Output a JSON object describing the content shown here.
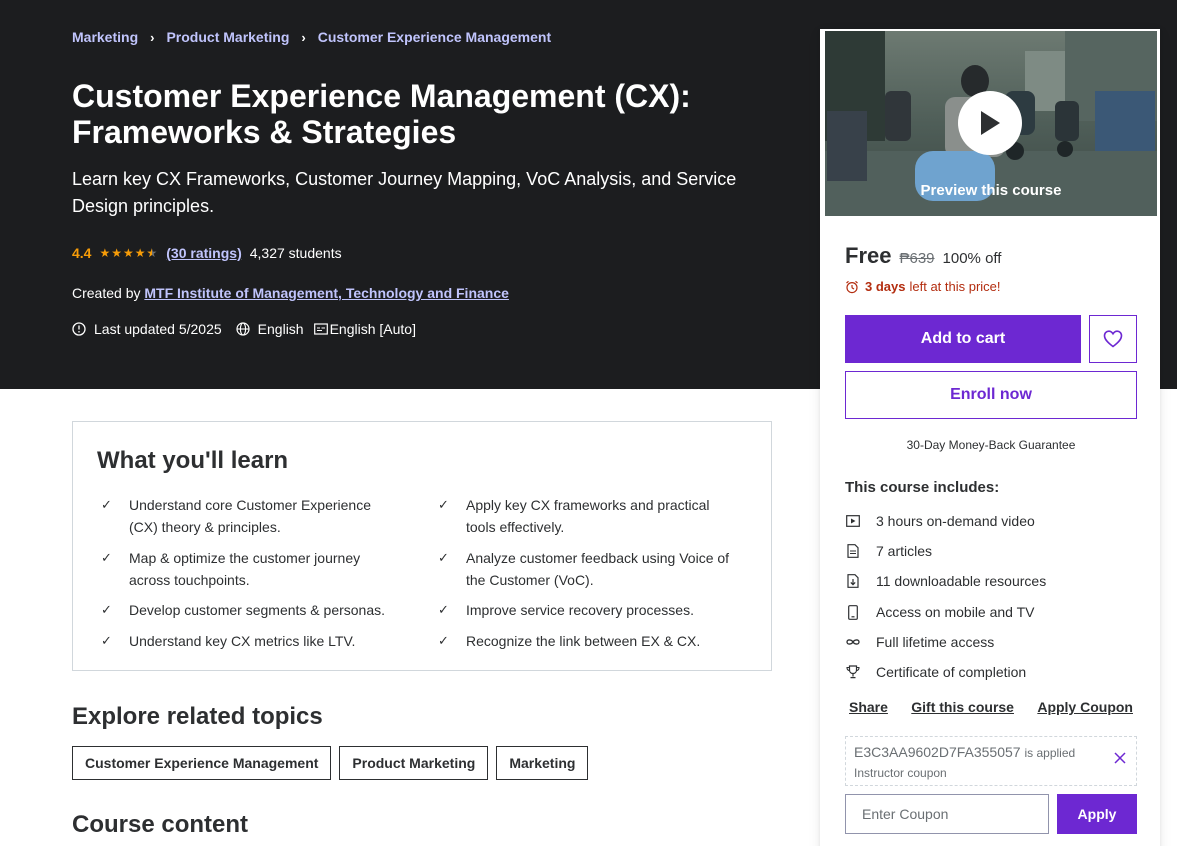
{
  "breadcrumb": [
    "Marketing",
    "Product Marketing",
    "Customer Experience Management"
  ],
  "course": {
    "title_line1": "Customer Experience Management (CX):",
    "title_line2": "Frameworks & Strategies",
    "subtitle": "Learn key CX Frameworks, Customer Journey Mapping, VoC Analysis, and Service Design principles.",
    "rating": "4.4",
    "rating_stars": 4.4,
    "ratings_count": "(30 ratings)",
    "students": "4,327 students",
    "created_by_label": "Created by",
    "instructor": "MTF Institute of Management, Technology and Finance",
    "last_updated": "Last updated 5/2025",
    "language": "English",
    "captions": "English [Auto]"
  },
  "learn": {
    "title": "What you'll learn",
    "items": [
      "Understand core Customer Experience (CX) theory & principles.",
      "Apply key CX frameworks and practical tools effectively.",
      "Map & optimize the customer journey across touchpoints.",
      "Analyze customer feedback using Voice of the Customer (VoC).",
      "Develop customer segments & personas.",
      "Improve service recovery processes.",
      "Understand key CX metrics like LTV.",
      "Recognize the link between EX & CX."
    ]
  },
  "related": {
    "title": "Explore related topics",
    "topics": [
      "Customer Experience Management",
      "Product Marketing",
      "Marketing"
    ]
  },
  "content_title": "Course content",
  "sidebar": {
    "preview_label": "Preview this course",
    "price": "Free",
    "original_price": "₱639",
    "discount": "100% off",
    "timer_bold": "3 days",
    "timer_rest": "left at this price!",
    "add_to_cart": "Add to cart",
    "enroll_now": "Enroll now",
    "guarantee": "30-Day Money-Back Guarantee",
    "includes_title": "This course includes:",
    "includes": [
      {
        "icon": "video-icon",
        "text": "3 hours on-demand video"
      },
      {
        "icon": "article-icon",
        "text": "7 articles"
      },
      {
        "icon": "download-icon",
        "text": "11 downloadable resources"
      },
      {
        "icon": "mobile-icon",
        "text": "Access on mobile and TV"
      },
      {
        "icon": "infinity-icon",
        "text": "Full lifetime access"
      },
      {
        "icon": "trophy-icon",
        "text": "Certificate of completion"
      }
    ],
    "share": "Share",
    "gift": "Gift this course",
    "apply_coupon": "Apply Coupon",
    "coupon_code": "E3C3AA9602D7FA355057",
    "coupon_applied": "is applied",
    "coupon_type": "Instructor coupon",
    "coupon_placeholder": "Enter Coupon",
    "apply": "Apply"
  },
  "colors": {
    "hero_bg": "#1c1d1f",
    "accent": "#6d28d2",
    "link_light": "#c0c4fc",
    "star": "#f69c08",
    "alert": "#b32d0f"
  }
}
